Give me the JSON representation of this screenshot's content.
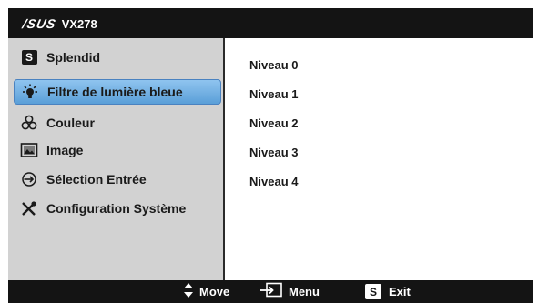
{
  "header": {
    "logo": "/SUS",
    "model": "VX278"
  },
  "sidebar": {
    "items": [
      {
        "label": "Splendid",
        "icon": "splendid-s-icon"
      },
      {
        "label": "Filtre de lumière bleue",
        "icon": "bluelight-filter-icon",
        "selected": true
      },
      {
        "label": "Couleur",
        "icon": "color-icon"
      },
      {
        "label": "Image",
        "icon": "image-icon"
      },
      {
        "label": "Sélection Entrée",
        "icon": "input-select-icon"
      },
      {
        "label": "Configuration Système",
        "icon": "system-setup-icon"
      }
    ]
  },
  "options": [
    "Niveau 0",
    "Niveau 1",
    "Niveau 2",
    "Niveau 3",
    "Niveau 4"
  ],
  "footer": {
    "move_label": "Move",
    "menu_label": "Menu",
    "exit_key": "S",
    "exit_label": "Exit"
  },
  "colors": {
    "highlight": "#6aaee4",
    "sidebar_bg": "#d2d2d2",
    "frame": "#1a1a1a"
  }
}
